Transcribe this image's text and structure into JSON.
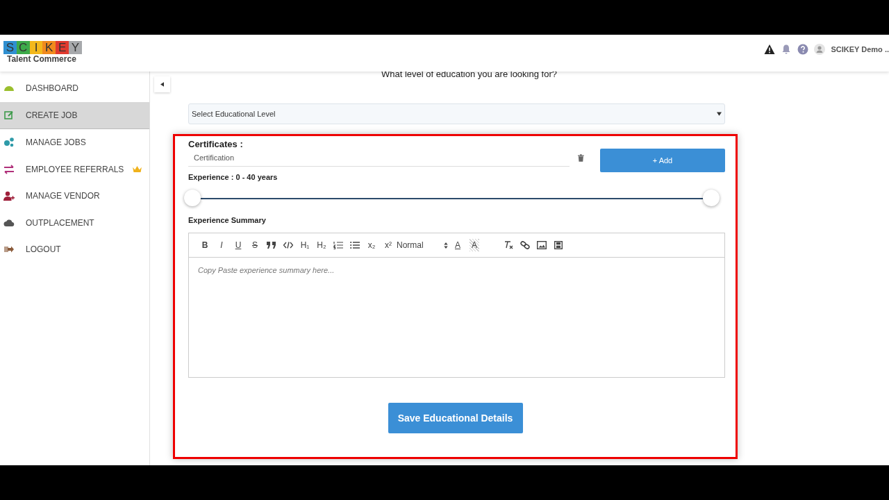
{
  "header": {
    "logo_letters": [
      {
        "char": "S",
        "color": "#2f8fd0"
      },
      {
        "char": "C",
        "color": "#3daa4a"
      },
      {
        "char": "I",
        "color": "#f3b81c"
      },
      {
        "char": "K",
        "color": "#f08a1d"
      },
      {
        "char": "E",
        "color": "#e03a2f"
      },
      {
        "char": "Y",
        "color": "#a7a9ac"
      }
    ],
    "logo_subtitle": "Talent Commerce",
    "user_name": "SCIKEY Demo .."
  },
  "sidebar": {
    "items": [
      {
        "label": "DASHBOARD",
        "selected": false,
        "premium": false
      },
      {
        "label": "CREATE JOB",
        "selected": true,
        "premium": false
      },
      {
        "label": "MANAGE JOBS",
        "selected": false,
        "premium": false
      },
      {
        "label": "EMPLOYEE REFERRALS",
        "selected": false,
        "premium": true
      },
      {
        "label": "MANAGE VENDOR",
        "selected": false,
        "premium": false
      },
      {
        "label": "OUTPLACEMENT",
        "selected": false,
        "premium": false
      },
      {
        "label": "LOGOUT",
        "selected": false,
        "premium": false
      }
    ]
  },
  "form": {
    "question": "What level of education you are looking for?",
    "education_select": {
      "placeholder": "Select Educational Level"
    },
    "certificates": {
      "label": "Certificates :",
      "field": {
        "placeholder": "Certification"
      },
      "add_button": "+ Add"
    },
    "experience": {
      "label": "Experience : 0 - 40 years",
      "thumbs": [
        {
          "level": 0
        },
        {
          "level": 1
        }
      ]
    },
    "summary": {
      "label": "Experience Summary",
      "toolbar": [
        {
          "kind": "bold",
          "label": "B"
        },
        {
          "kind": "italic",
          "label": "I"
        },
        {
          "kind": "underline",
          "label": "U"
        },
        {
          "kind": "strike",
          "label": "S"
        },
        {
          "kind": "quote"
        },
        {
          "kind": "code"
        },
        {
          "kind": "glyph",
          "label": "H₁"
        },
        {
          "kind": "glyph",
          "label": "H₂"
        },
        {
          "kind": "ol"
        },
        {
          "kind": "ul"
        },
        {
          "kind": "glyph",
          "label": "x₂"
        },
        {
          "kind": "glyph",
          "label": "x²"
        },
        {
          "kind": "select",
          "label": "Normal"
        },
        {
          "kind": "color",
          "label": "A"
        },
        {
          "kind": "background",
          "label": "A"
        },
        {
          "kind": "clean"
        },
        {
          "kind": "link"
        },
        {
          "kind": "image"
        },
        {
          "kind": "video"
        }
      ],
      "placeholder": "Copy Paste experience summary here..."
    },
    "save_button": "Save Educational Details"
  }
}
